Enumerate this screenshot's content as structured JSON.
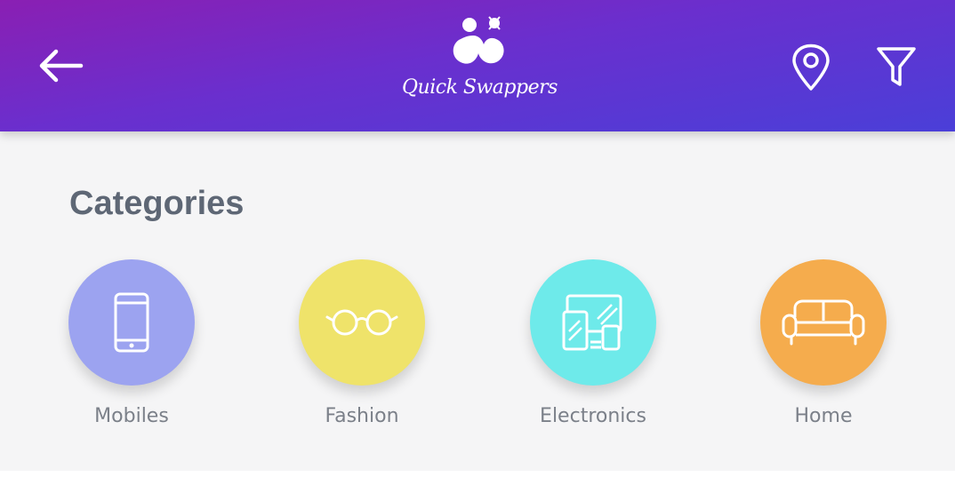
{
  "header": {
    "logo_text": "Quick Swappers",
    "icons": {
      "back": "arrow-left-icon",
      "location": "map-pin-icon",
      "filter": "funnel-icon"
    },
    "gradient_colors": [
      "#8a1fb3",
      "#4a3fd8"
    ]
  },
  "categories": {
    "title": "Categories",
    "items": [
      {
        "label": "Mobiles",
        "icon": "smartphone-icon",
        "color": "#9ca3f0"
      },
      {
        "label": "Fashion",
        "icon": "glasses-icon",
        "color": "#efe36a"
      },
      {
        "label": "Electronics",
        "icon": "devices-icon",
        "color": "#6eeaea"
      },
      {
        "label": "Home",
        "icon": "sofa-icon",
        "color": "#f5ac4d"
      }
    ]
  }
}
